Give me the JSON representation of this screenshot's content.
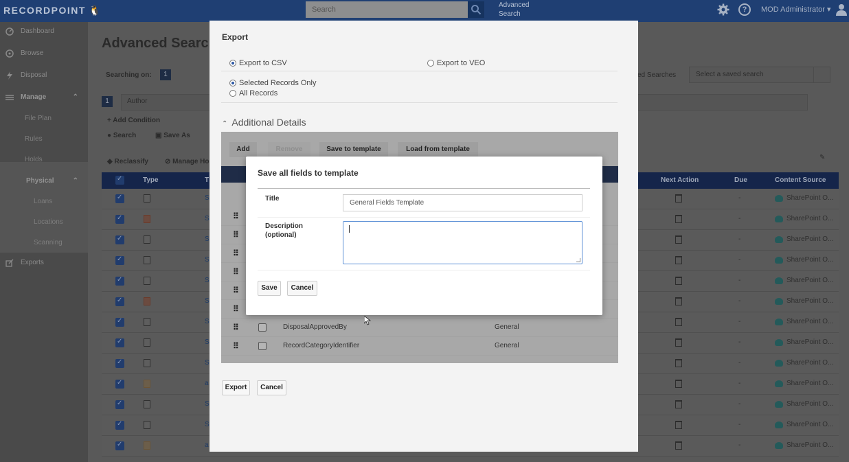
{
  "topbar": {
    "logo_text": "RECORDPOINT",
    "search_placeholder": "Search",
    "advanced_search_label": "Advanced Search",
    "user_name": "MOD Administrator",
    "user_caret": "▾"
  },
  "sidebar": {
    "items": [
      {
        "label": "Dashboard",
        "icon": "dashboard-icon"
      },
      {
        "label": "Browse",
        "icon": "browse-icon"
      },
      {
        "label": "Disposal",
        "icon": "disposal-icon"
      },
      {
        "label": "Manage",
        "icon": "manage-icon"
      }
    ],
    "manage_children": [
      "File Plan",
      "Rules",
      "Holds"
    ],
    "physical_label": "Physical",
    "physical_children": [
      "Loans",
      "Locations",
      "Scanning"
    ],
    "exports_label": "Exports"
  },
  "main": {
    "title": "Advanced Searc",
    "searching_on_label": "Searching on:",
    "searching_on_count": "1",
    "condition_number": "1",
    "condition_field": "Author",
    "add_condition_label": "Add Condition",
    "search_label": "Search",
    "save_as_label": "Save As",
    "saved_searches_label": "ed Searches",
    "saved_search_placeholder": "Select a saved search",
    "reclassify_label": "Reclassify",
    "manage_holds_label": "Manage Ho",
    "columns": {
      "type": "Type",
      "title_stub": "T",
      "next_action": "Next Action",
      "due": "Due",
      "content_source": "Content Source"
    },
    "rows": [
      {
        "icon": "doc",
        "link": "S",
        "due": "-",
        "source": "SharePoint O..."
      },
      {
        "icon": "red",
        "link": "S",
        "due": "-",
        "source": "SharePoint O..."
      },
      {
        "icon": "doc",
        "link": "S",
        "due": "-",
        "source": "SharePoint O..."
      },
      {
        "icon": "doc",
        "link": "S",
        "due": "-",
        "source": "SharePoint O..."
      },
      {
        "icon": "doc",
        "link": "S",
        "due": "-",
        "source": "SharePoint O..."
      },
      {
        "icon": "red",
        "link": "S",
        "due": "-",
        "source": "SharePoint O..."
      },
      {
        "icon": "doc",
        "link": "S",
        "due": "-",
        "source": "SharePoint O..."
      },
      {
        "icon": "doc",
        "link": "S",
        "due": "-",
        "source": "SharePoint O..."
      },
      {
        "icon": "doc",
        "link": "S",
        "due": "-",
        "source": "SharePoint O..."
      },
      {
        "icon": "orange",
        "link": "a",
        "due": "-",
        "source": "SharePoint O..."
      },
      {
        "icon": "doc",
        "link": "S",
        "due": "-",
        "source": "SharePoint O..."
      },
      {
        "icon": "doc",
        "link": "S",
        "due": "-",
        "source": "SharePoint O..."
      },
      {
        "icon": "orange",
        "link": "a",
        "due": "-",
        "source": "SharePoint O..."
      }
    ]
  },
  "export": {
    "title": "Export",
    "csv_label": "Export to CSV",
    "veo_label": "Export to VEO",
    "selected_only_label": "Selected Records Only",
    "all_records_label": "All Records",
    "additional_details_label": "Additional Details",
    "toolbar": {
      "add": "Add",
      "remove": "Remove",
      "save_template": "Save to template",
      "load_template": "Load from template"
    },
    "fields": [
      {
        "name": "DisposalApprovedBy",
        "category": "General"
      },
      {
        "name": "RecordCategoryIdentifier",
        "category": "General"
      }
    ],
    "export_button": "Export",
    "cancel_button": "Cancel"
  },
  "template_dialog": {
    "title": "Save all fields to template",
    "title_label": "Title",
    "title_value": "General Fields Template",
    "description_label_1": "Description",
    "description_label_2": "(optional)",
    "save_button": "Save",
    "cancel_button": "Cancel"
  }
}
